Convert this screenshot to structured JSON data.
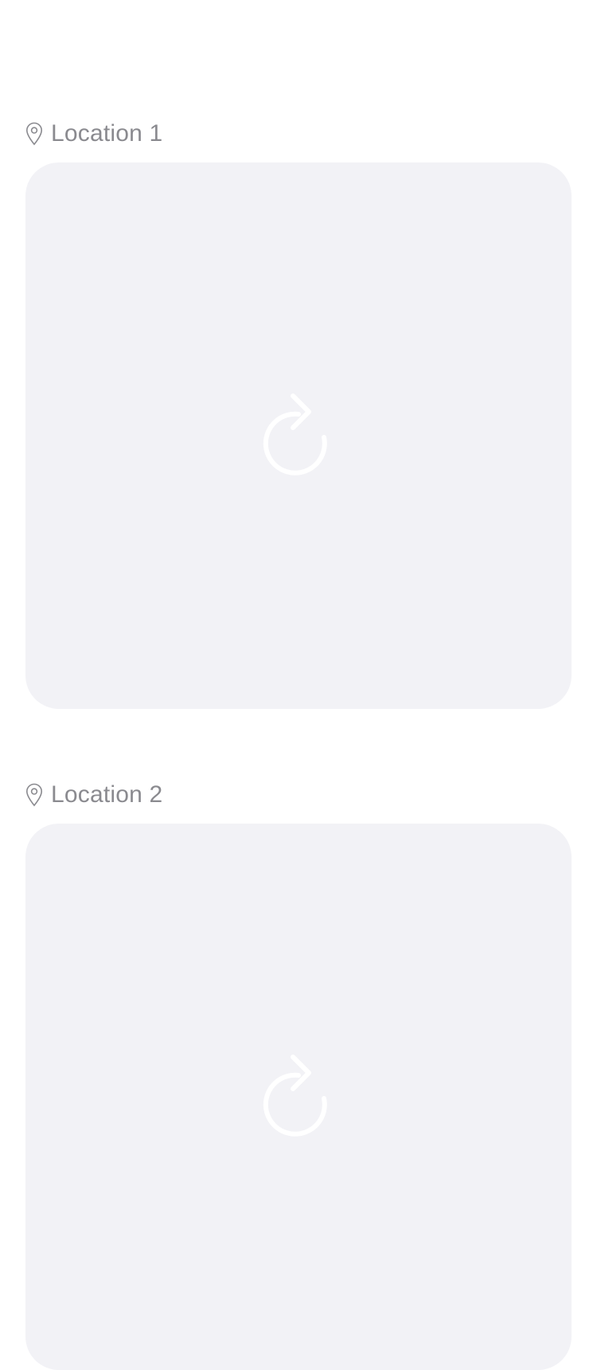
{
  "locations": [
    {
      "label": "Location 1",
      "icon": "map-pin-icon",
      "placeholder_icon": "reload-icon"
    },
    {
      "label": "Location 2",
      "icon": "map-pin-icon",
      "placeholder_icon": "reload-icon"
    }
  ],
  "colors": {
    "background": "#ffffff",
    "card": "#f2f2f6",
    "label": "#8a8a8f",
    "icon_on_card": "#ffffff"
  }
}
